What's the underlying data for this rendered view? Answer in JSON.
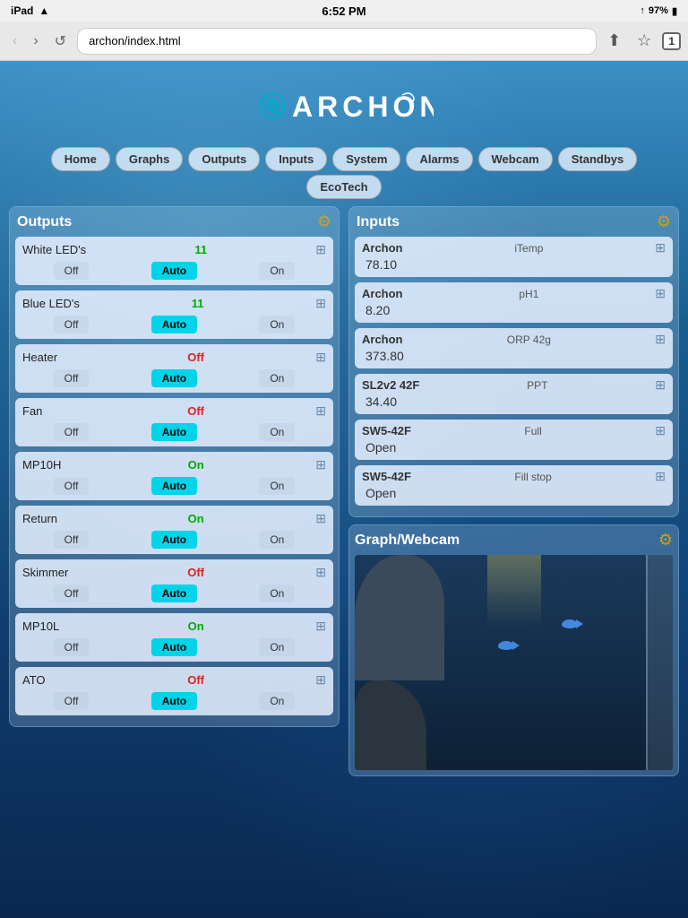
{
  "statusBar": {
    "carrier": "iPad",
    "wifi": "wifi",
    "time": "6:52 PM",
    "signal": "↑",
    "battery": "97%"
  },
  "browser": {
    "back": "‹",
    "forward": "›",
    "reload": "↺",
    "url": "archon/index.html",
    "tab_count": "1"
  },
  "logo": {
    "text": "ARCHON"
  },
  "nav": {
    "items": [
      {
        "label": "Home",
        "id": "home"
      },
      {
        "label": "Graphs",
        "id": "graphs"
      },
      {
        "label": "Outputs",
        "id": "outputs"
      },
      {
        "label": "Inputs",
        "id": "inputs"
      },
      {
        "label": "System",
        "id": "system"
      },
      {
        "label": "Alarms",
        "id": "alarms"
      },
      {
        "label": "Webcam",
        "id": "webcam"
      },
      {
        "label": "Standbys",
        "id": "standbys"
      }
    ],
    "ecotech": "EcoTech"
  },
  "outputs": {
    "title": "Outputs",
    "items": [
      {
        "name": "White LED's",
        "status": "11",
        "status_type": "green",
        "controls": [
          "Off",
          "Auto",
          "On"
        ],
        "active": "Auto"
      },
      {
        "name": "Blue LED's",
        "status": "11",
        "status_type": "green",
        "controls": [
          "Off",
          "Auto",
          "On"
        ],
        "active": "Auto"
      },
      {
        "name": "Heater",
        "status": "Off",
        "status_type": "red",
        "controls": [
          "Off",
          "Auto",
          "On"
        ],
        "active": "Auto"
      },
      {
        "name": "Fan",
        "status": "Off",
        "status_type": "red",
        "controls": [
          "Off",
          "Auto",
          "On"
        ],
        "active": "Auto"
      },
      {
        "name": "MP10H",
        "status": "On",
        "status_type": "green",
        "controls": [
          "Off",
          "Auto",
          "On"
        ],
        "active": "Auto"
      },
      {
        "name": "Return",
        "status": "On",
        "status_type": "green",
        "controls": [
          "Off",
          "Auto",
          "On"
        ],
        "active": "Auto"
      },
      {
        "name": "Skimmer",
        "status": "Off",
        "status_type": "red",
        "controls": [
          "Off",
          "Auto",
          "On"
        ],
        "active": "Auto"
      },
      {
        "name": "MP10L",
        "status": "On",
        "status_type": "green",
        "controls": [
          "Off",
          "Auto",
          "On"
        ],
        "active": "Auto"
      },
      {
        "name": "ATO",
        "status": "Off",
        "status_type": "red",
        "controls": [
          "Off",
          "Auto",
          "On"
        ],
        "active": "Auto"
      }
    ]
  },
  "inputs": {
    "title": "Inputs",
    "items": [
      {
        "source": "Archon",
        "label": "iTemp",
        "value": "78.10"
      },
      {
        "source": "Archon",
        "label": "pH1",
        "value": "8.20"
      },
      {
        "source": "Archon",
        "label": "ORP 42g",
        "value": "373.80"
      },
      {
        "source": "SL2v2 42F",
        "label": "PPT",
        "value": "34.40"
      },
      {
        "source": "SW5-42F",
        "label": "Full",
        "value": "Open"
      },
      {
        "source": "SW5-42F",
        "label": "Fill stop",
        "value": "Open"
      }
    ]
  },
  "webcam": {
    "title": "Graph/Webcam"
  }
}
